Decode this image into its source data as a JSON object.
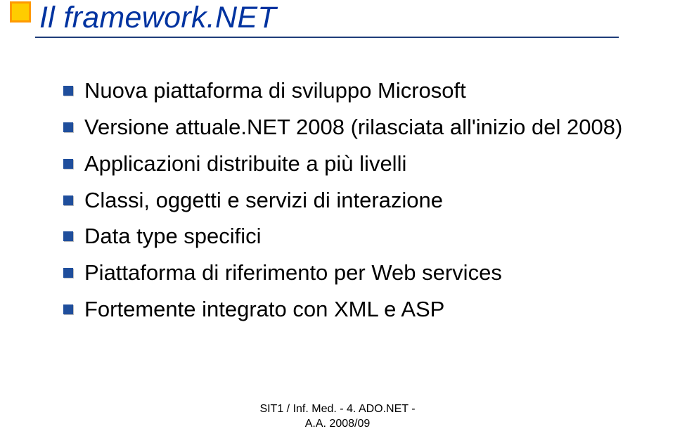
{
  "accent_color_outer": "#ff9900",
  "accent_color_inner": "#ffcc00",
  "bullet_color": "#1f4e9c",
  "title": "Il framework.NET",
  "bullets": [
    "Nuova piattaforma di sviluppo Microsoft",
    "Versione attuale.NET 2008 (rilasciata all'inizio del 2008)",
    "Applicazioni distribuite a più livelli",
    "Classi, oggetti e servizi di interazione",
    "Data type specifici",
    "Piattaforma di riferimento per Web services",
    "Fortemente integrato con XML e ASP"
  ],
  "footer": {
    "line1": "SIT1 / Inf. Med. - 4. ADO.NET -",
    "line2": "A.A. 2008/09"
  }
}
